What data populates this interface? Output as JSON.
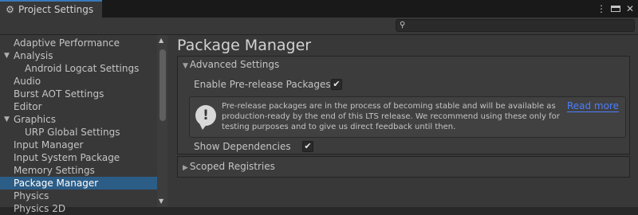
{
  "window": {
    "tab_title": "Project Settings",
    "menu_icon": "kebab-menu-icon",
    "maximize_icon": "maximize-icon",
    "close_icon": "close-icon"
  },
  "search": {
    "placeholder": "",
    "value": ""
  },
  "sidebar": {
    "items": [
      {
        "label": "Adaptive Performance",
        "indent": false,
        "expandable": false,
        "selected": false
      },
      {
        "label": "Analysis",
        "indent": false,
        "expandable": true,
        "selected": false
      },
      {
        "label": "Android Logcat Settings",
        "indent": true,
        "expandable": false,
        "selected": false
      },
      {
        "label": "Audio",
        "indent": false,
        "expandable": false,
        "selected": false
      },
      {
        "label": "Burst AOT Settings",
        "indent": false,
        "expandable": false,
        "selected": false
      },
      {
        "label": "Editor",
        "indent": false,
        "expandable": false,
        "selected": false
      },
      {
        "label": "Graphics",
        "indent": false,
        "expandable": true,
        "selected": false
      },
      {
        "label": "URP Global Settings",
        "indent": true,
        "expandable": false,
        "selected": false
      },
      {
        "label": "Input Manager",
        "indent": false,
        "expandable": false,
        "selected": false
      },
      {
        "label": "Input System Package",
        "indent": false,
        "expandable": false,
        "selected": false
      },
      {
        "label": "Memory Settings",
        "indent": false,
        "expandable": false,
        "selected": false
      },
      {
        "label": "Package Manager",
        "indent": false,
        "expandable": false,
        "selected": true
      },
      {
        "label": "Physics",
        "indent": false,
        "expandable": false,
        "selected": false
      },
      {
        "label": "Physics 2D",
        "indent": false,
        "expandable": false,
        "selected": false
      }
    ]
  },
  "main": {
    "title": "Package Manager",
    "advanced": {
      "header": "Advanced Settings",
      "prerelease_label": "Enable Pre-release Packages",
      "prerelease_checked": true,
      "help_lines": [
        "Pre-release packages are in the process of becoming stable and will be available as",
        "production-ready by the end of this LTS release. We recommend using these only for",
        "testing purposes and to give us direct feedback until then."
      ],
      "read_more": "Read more",
      "dependencies_label": "Show Dependencies",
      "dependencies_checked": true
    },
    "scoped": {
      "header": "Scoped Registries"
    }
  },
  "colors": {
    "selection": "#2c5d87",
    "link": "#4c7eff",
    "tab_accent": "#3a79bb"
  }
}
